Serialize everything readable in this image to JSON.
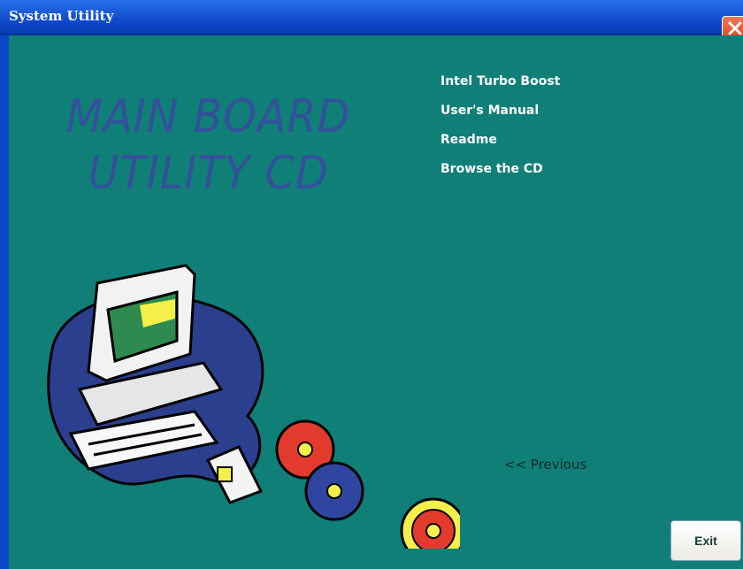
{
  "window": {
    "title": "System Utility"
  },
  "hero": {
    "line1": "MAIN BOARD",
    "line2": "UTILITY  CD"
  },
  "menu": {
    "items": [
      {
        "label": "Intel Turbo Boost"
      },
      {
        "label": "User's Manual"
      },
      {
        "label": "Readme"
      },
      {
        "label": "Browse the CD"
      }
    ]
  },
  "navigation": {
    "previous_label": "<< Previous",
    "exit_label": "Exit"
  },
  "colors": {
    "background": "#0f7f78",
    "titlebar": "#0a3cb0",
    "hero_text": "#33509a",
    "menu_text": "#ffffff"
  },
  "icons": {
    "illustration": "computer-with-cds-icon",
    "close": "close-icon"
  }
}
